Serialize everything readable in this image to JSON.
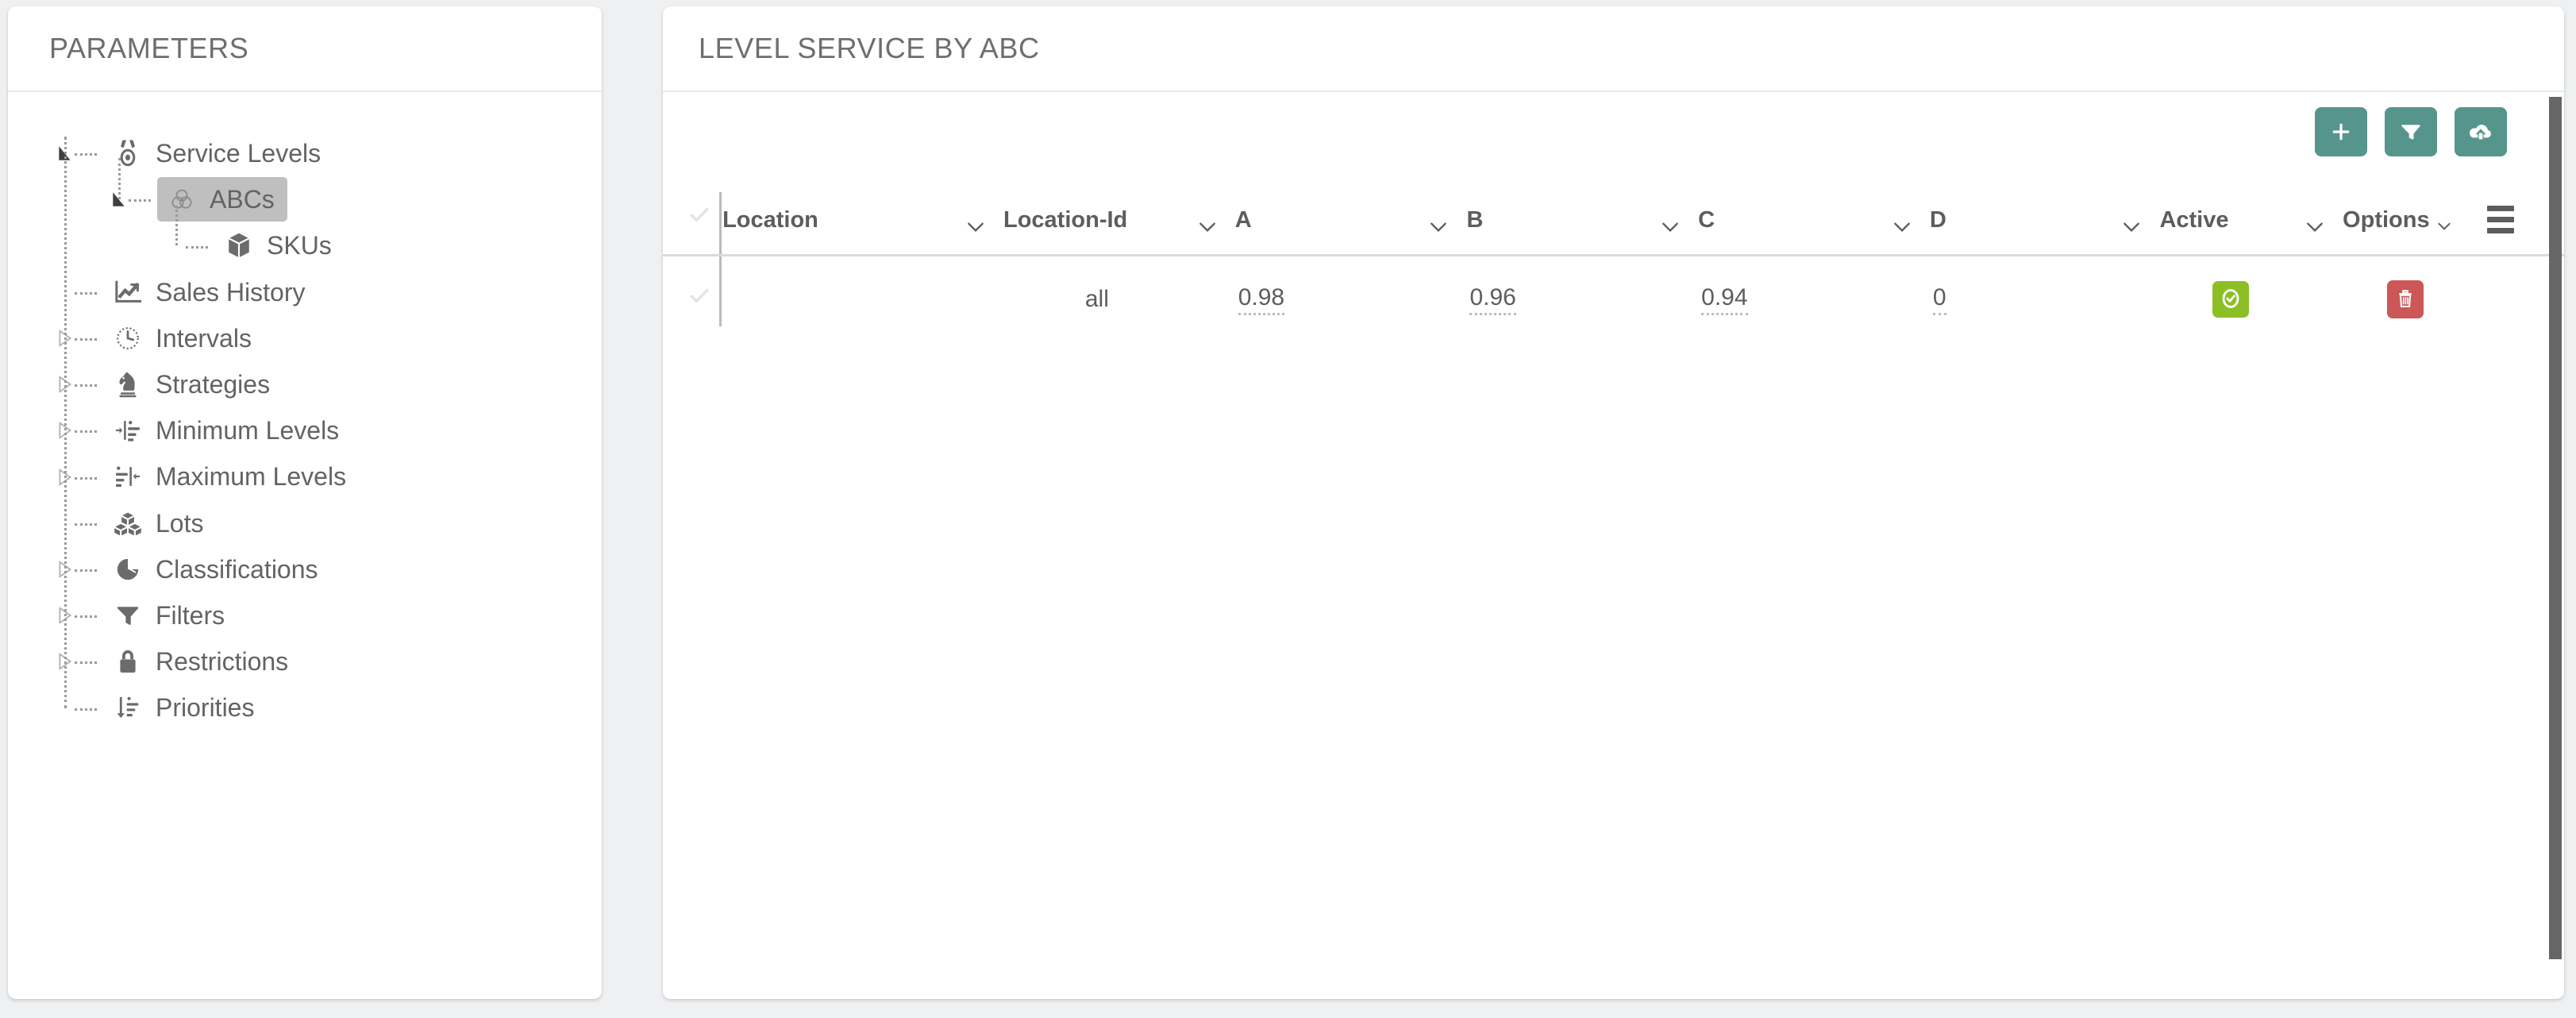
{
  "sidebar": {
    "title": "PARAMETERS",
    "items": [
      {
        "label": "Service Levels",
        "icon": "medal-icon",
        "depth": 0,
        "toggle": "open",
        "selected": false
      },
      {
        "label": "ABCs",
        "icon": "venn-circles-icon",
        "depth": 1,
        "toggle": "open",
        "selected": true
      },
      {
        "label": "SKUs",
        "icon": "cube-icon",
        "depth": 2,
        "toggle": "none",
        "selected": false
      },
      {
        "label": "Sales History",
        "icon": "line-chart-icon",
        "depth": 0,
        "toggle": "none",
        "selected": false
      },
      {
        "label": "Intervals",
        "icon": "clock-icon",
        "depth": 0,
        "toggle": "closed",
        "selected": false
      },
      {
        "label": "Strategies",
        "icon": "chess-knight-icon",
        "depth": 0,
        "toggle": "closed",
        "selected": false
      },
      {
        "label": "Minimum Levels",
        "icon": "min-levels-icon",
        "depth": 0,
        "toggle": "closed",
        "selected": false
      },
      {
        "label": "Maximum Levels",
        "icon": "max-levels-icon",
        "depth": 0,
        "toggle": "closed",
        "selected": false
      },
      {
        "label": "Lots",
        "icon": "boxes-icon",
        "depth": 0,
        "toggle": "none",
        "selected": false
      },
      {
        "label": "Classifications",
        "icon": "pie-chart-icon",
        "depth": 0,
        "toggle": "closed",
        "selected": false
      },
      {
        "label": "Filters",
        "icon": "funnel-icon",
        "depth": 0,
        "toggle": "closed",
        "selected": false
      },
      {
        "label": "Restrictions",
        "icon": "lock-icon",
        "depth": 0,
        "toggle": "closed",
        "selected": false
      },
      {
        "label": "Priorities",
        "icon": "sort-amount-icon",
        "depth": 0,
        "toggle": "none",
        "selected": false
      }
    ]
  },
  "main": {
    "title": "LEVEL SERVICE BY ABC",
    "toolbar": {
      "add": {
        "name": "add-button",
        "icon": "plus-icon",
        "color": "#56958c"
      },
      "filter": {
        "name": "filter-button",
        "icon": "funnel-icon",
        "color": "#56958c"
      },
      "upload": {
        "name": "upload-button",
        "icon": "cloud-upload-icon",
        "color": "#56958c"
      }
    },
    "table": {
      "columns": [
        {
          "label": "Location",
          "sortable": true
        },
        {
          "label": "Location-Id",
          "sortable": true
        },
        {
          "label": "A",
          "sortable": true
        },
        {
          "label": "B",
          "sortable": true
        },
        {
          "label": "C",
          "sortable": true
        },
        {
          "label": "D",
          "sortable": true
        },
        {
          "label": "Active",
          "sortable": true
        },
        {
          "label": "Options",
          "sortable": true
        }
      ],
      "rows": [
        {
          "location": "",
          "location_id": "all",
          "a": "0.98",
          "b": "0.96",
          "c": "0.94",
          "d": "0",
          "active": true,
          "delete_label": "trash-icon"
        }
      ]
    }
  },
  "colors": {
    "accent_teal": "#56958c",
    "badge_green": "#8cbf26",
    "badge_red": "#cc5757",
    "page_bg": "#eef0f2",
    "text": "#5d5d5d"
  }
}
